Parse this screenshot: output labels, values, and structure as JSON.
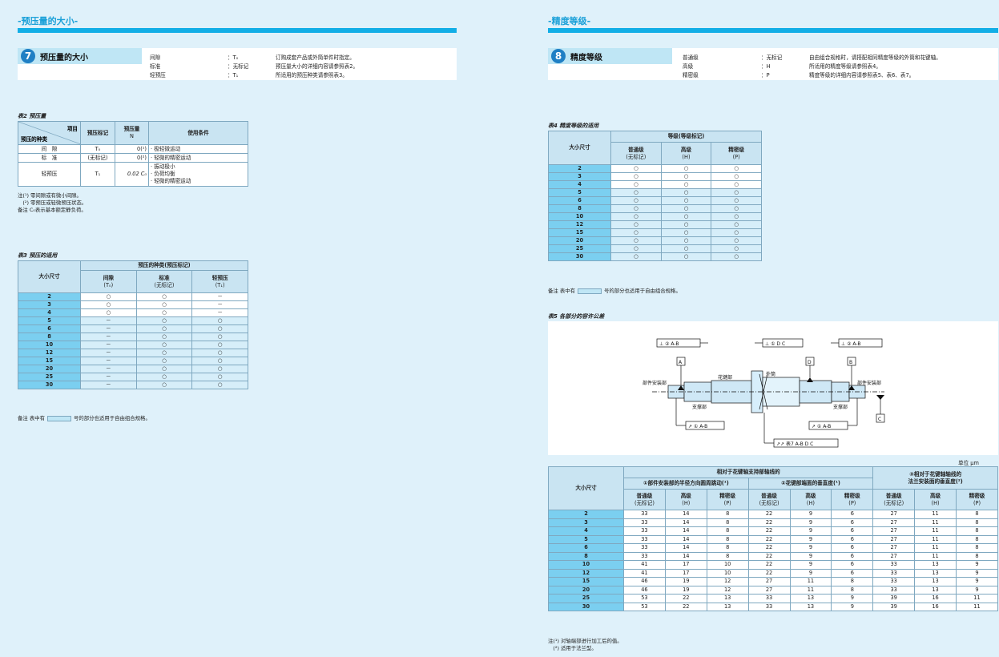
{
  "left": {
    "header": "-预压量的大小-",
    "section": {
      "number": "7",
      "title": "预压量的大小",
      "rows": [
        {
          "name": "间隙",
          "mark": "：T₀",
          "text": "订购成套产品或外筒单件时指定。"
        },
        {
          "name": "标准",
          "mark": "：无标记",
          "text": "预压量大小的详细内容请参照表2。"
        },
        {
          "name": "轻预压",
          "mark": "：T₁",
          "text": "所适用的预压种类请参照表3。"
        }
      ]
    },
    "table2": {
      "caption": "表2  预压量",
      "corner_top": "项目",
      "corner_bottom": "预压的种类",
      "headers": [
        "预压标记",
        "预压量",
        "N",
        "使用条件"
      ],
      "rows": [
        {
          "kind": "间　隙",
          "mark": "T₀",
          "amount": "0(¹)",
          "cond": [
            "· 极轻微运动"
          ]
        },
        {
          "kind": "标　准",
          "mark": "(无标记)",
          "amount": "0(²)",
          "cond": [
            "· 轻微的精密运动"
          ]
        },
        {
          "kind": "轻预压",
          "mark": "T₁",
          "amount": "0.02 C₀",
          "cond": [
            "· 振动极小",
            "· 负荷均衡",
            "· 轻微的精密运动"
          ]
        }
      ],
      "notes": [
        "注(¹)  零间隙或有微小间隙。",
        "　(²)  零预压或轻微预压状态。",
        "备注  C₀表示基本额定静负荷。"
      ]
    },
    "table3": {
      "caption": "表3  预压的适用",
      "size_header": "大小尺寸",
      "group_header": "预压的种类(预压标记)",
      "cols": [
        {
          "name": "间隙",
          "mark": "(T₀)"
        },
        {
          "name": "标准",
          "mark": "(无标记)"
        },
        {
          "name": "轻预压",
          "mark": "(T₁)"
        }
      ],
      "rows": [
        {
          "size": "2",
          "v": [
            "○",
            "○",
            "－"
          ]
        },
        {
          "size": "3",
          "v": [
            "○",
            "○",
            "－"
          ]
        },
        {
          "size": "4",
          "v": [
            "○",
            "○",
            "－"
          ]
        },
        {
          "size": "5",
          "v": [
            "－",
            "○",
            "○"
          ]
        },
        {
          "size": "6",
          "v": [
            "－",
            "○",
            "○"
          ]
        },
        {
          "size": "8",
          "v": [
            "－",
            "○",
            "○"
          ]
        },
        {
          "size": "10",
          "v": [
            "－",
            "○",
            "○"
          ]
        },
        {
          "size": "12",
          "v": [
            "－",
            "○",
            "○"
          ]
        },
        {
          "size": "15",
          "v": [
            "－",
            "○",
            "○"
          ]
        },
        {
          "size": "20",
          "v": [
            "－",
            "○",
            "○"
          ]
        },
        {
          "size": "25",
          "v": [
            "－",
            "○",
            "○"
          ]
        },
        {
          "size": "30",
          "v": [
            "－",
            "○",
            "○"
          ]
        }
      ],
      "free_rows": [
        "5",
        "6",
        "8",
        "10",
        "12",
        "15",
        "20",
        "25",
        "30"
      ],
      "note_prefix": "备注  表中有",
      "note_suffix": "号的部分也适用于自由组合规格。"
    }
  },
  "right": {
    "header": "-精度等级-",
    "section": {
      "number": "8",
      "title": "精度等级",
      "rows": [
        {
          "name": "普通级",
          "mark": "：无标记",
          "text": "自由组合规格时，请搭配相同精度等级的外筒和花键轴。"
        },
        {
          "name": "高级",
          "mark": "：H",
          "text": "所适用的精度等级请参照表4。"
        },
        {
          "name": "精密级",
          "mark": "：P",
          "text": "精度等级的详细内容请参照表5、表6、表7。"
        }
      ]
    },
    "table4": {
      "caption": "表4  精度等级的适用",
      "size_header": "大小尺寸",
      "group_header": "等级(等级标记)",
      "cols": [
        {
          "name": "普通级",
          "mark": "(无标记)"
        },
        {
          "name": "高级",
          "mark": "(H)"
        },
        {
          "name": "精密级",
          "mark": "(P)"
        }
      ],
      "rows": [
        {
          "size": "2",
          "v": [
            "○",
            "○",
            "○"
          ]
        },
        {
          "size": "3",
          "v": [
            "○",
            "○",
            "○"
          ]
        },
        {
          "size": "4",
          "v": [
            "○",
            "○",
            "○"
          ]
        },
        {
          "size": "5",
          "v": [
            "○",
            "○",
            "○"
          ]
        },
        {
          "size": "6",
          "v": [
            "○",
            "○",
            "○"
          ]
        },
        {
          "size": "8",
          "v": [
            "○",
            "○",
            "○"
          ]
        },
        {
          "size": "10",
          "v": [
            "○",
            "○",
            "○"
          ]
        },
        {
          "size": "12",
          "v": [
            "○",
            "○",
            "○"
          ]
        },
        {
          "size": "15",
          "v": [
            "○",
            "○",
            "○"
          ]
        },
        {
          "size": "20",
          "v": [
            "○",
            "○",
            "○"
          ]
        },
        {
          "size": "25",
          "v": [
            "○",
            "○",
            "○"
          ]
        },
        {
          "size": "30",
          "v": [
            "○",
            "○",
            "○"
          ]
        }
      ],
      "free_rows": [
        "5",
        "6",
        "8",
        "10",
        "12",
        "15",
        "20",
        "25",
        "30"
      ],
      "note_prefix": "备注  表中有",
      "note_suffix": "号的部分也适用于自由组合规格。"
    },
    "table5": {
      "caption": "表5  各部分的容许公差",
      "diagram": {
        "frame_left": "⊥ ② A-B",
        "frame_mid": "⊥ ① D C",
        "frame_right": "⊥ ② A-B",
        "datum_a": "A",
        "datum_d": "D",
        "datum_b": "B",
        "datum_c": "C",
        "label_mount_l": "部件安装部",
        "label_mount_r": "部件安装部",
        "label_spline": "花键部",
        "label_outer": "外筒",
        "label_support_l": "支撑部",
        "label_support_r": "支撑部",
        "runout_l": "↗ ① A-B",
        "runout_r": "↗ ① A-B",
        "total_runout": "↗↗ 表7  A-B  D  C"
      },
      "unit": "单位 μm",
      "size_header": "大小尺寸",
      "group1": "相对于花键轴支持部轴线的",
      "sub1": "①部件安装部的半径方向圆周跳动(¹)",
      "sub2": "②花键部端面的垂直度(¹)",
      "group3_l1": "③相对于花键轴轴线的",
      "group3_l2": "法兰安装面的垂直度(²)",
      "cols": [
        {
          "name": "普通级",
          "mark": "(无标记)"
        },
        {
          "name": "高级",
          "mark": "(H)"
        },
        {
          "name": "精密级",
          "mark": "(P)"
        },
        {
          "name": "普通级",
          "mark": "(无标记)"
        },
        {
          "name": "高级",
          "mark": "(H)"
        },
        {
          "name": "精密级",
          "mark": "(P)"
        },
        {
          "name": "普通级",
          "mark": "(无标记)"
        },
        {
          "name": "高级",
          "mark": "(H)"
        },
        {
          "name": "精密级",
          "mark": "(P)"
        }
      ],
      "rows": [
        {
          "size": "2",
          "v": [
            "33",
            "14",
            "8",
            "22",
            "9",
            "6",
            "27",
            "11",
            "8"
          ]
        },
        {
          "size": "3",
          "v": [
            "33",
            "14",
            "8",
            "22",
            "9",
            "6",
            "27",
            "11",
            "8"
          ]
        },
        {
          "size": "4",
          "v": [
            "33",
            "14",
            "8",
            "22",
            "9",
            "6",
            "27",
            "11",
            "8"
          ]
        },
        {
          "size": "5",
          "v": [
            "33",
            "14",
            "8",
            "22",
            "9",
            "6",
            "27",
            "11",
            "8"
          ]
        },
        {
          "size": "6",
          "v": [
            "33",
            "14",
            "8",
            "22",
            "9",
            "6",
            "27",
            "11",
            "8"
          ]
        },
        {
          "size": "8",
          "v": [
            "33",
            "14",
            "8",
            "22",
            "9",
            "6",
            "27",
            "11",
            "8"
          ]
        },
        {
          "size": "10",
          "v": [
            "41",
            "17",
            "10",
            "22",
            "9",
            "6",
            "33",
            "13",
            "9"
          ]
        },
        {
          "size": "12",
          "v": [
            "41",
            "17",
            "10",
            "22",
            "9",
            "6",
            "33",
            "13",
            "9"
          ]
        },
        {
          "size": "15",
          "v": [
            "46",
            "19",
            "12",
            "27",
            "11",
            "8",
            "33",
            "13",
            "9"
          ]
        },
        {
          "size": "20",
          "v": [
            "46",
            "19",
            "12",
            "27",
            "11",
            "8",
            "33",
            "13",
            "9"
          ]
        },
        {
          "size": "25",
          "v": [
            "53",
            "22",
            "13",
            "33",
            "13",
            "9",
            "39",
            "16",
            "11"
          ]
        },
        {
          "size": "30",
          "v": [
            "53",
            "22",
            "13",
            "33",
            "13",
            "9",
            "39",
            "16",
            "11"
          ]
        }
      ],
      "notes": [
        "注(¹)  对轴端部进行加工后的值。",
        "　(²)  适用于法兰型。"
      ]
    }
  }
}
